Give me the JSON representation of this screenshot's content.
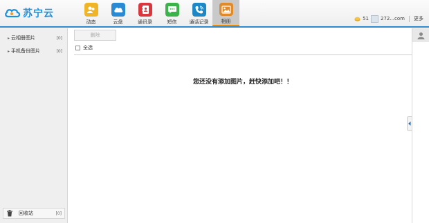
{
  "brand": {
    "name": "苏宁云",
    "color": "#1f8fd8"
  },
  "nav": [
    {
      "label": "动态",
      "icon": "activity-icon",
      "color": "#f0b429"
    },
    {
      "label": "云盘",
      "icon": "cloud-icon",
      "color": "#2a8ad4"
    },
    {
      "label": "通讯录",
      "icon": "contacts-icon",
      "color": "#d9363e"
    },
    {
      "label": "短信",
      "icon": "sms-icon",
      "color": "#3bb34a"
    },
    {
      "label": "通话记录",
      "icon": "call-log-icon",
      "color": "#1e88c7"
    },
    {
      "label": "相册",
      "icon": "album-icon",
      "color": "#e08a2a",
      "active": true
    }
  ],
  "user": {
    "coins": "51",
    "account": "272...com",
    "more": "更多"
  },
  "sidebar": {
    "items": [
      {
        "label": "云相册图片",
        "count": "[0]"
      },
      {
        "label": "手机备份图片",
        "count": "[0]"
      }
    ],
    "recycle": {
      "label": "回收站",
      "count": "[0]"
    }
  },
  "main": {
    "delete_label": "删除",
    "select_all": "全选",
    "empty_message": "您还没有添加图片，赶快添加吧！！"
  },
  "accent_color": "#2a8ad4"
}
